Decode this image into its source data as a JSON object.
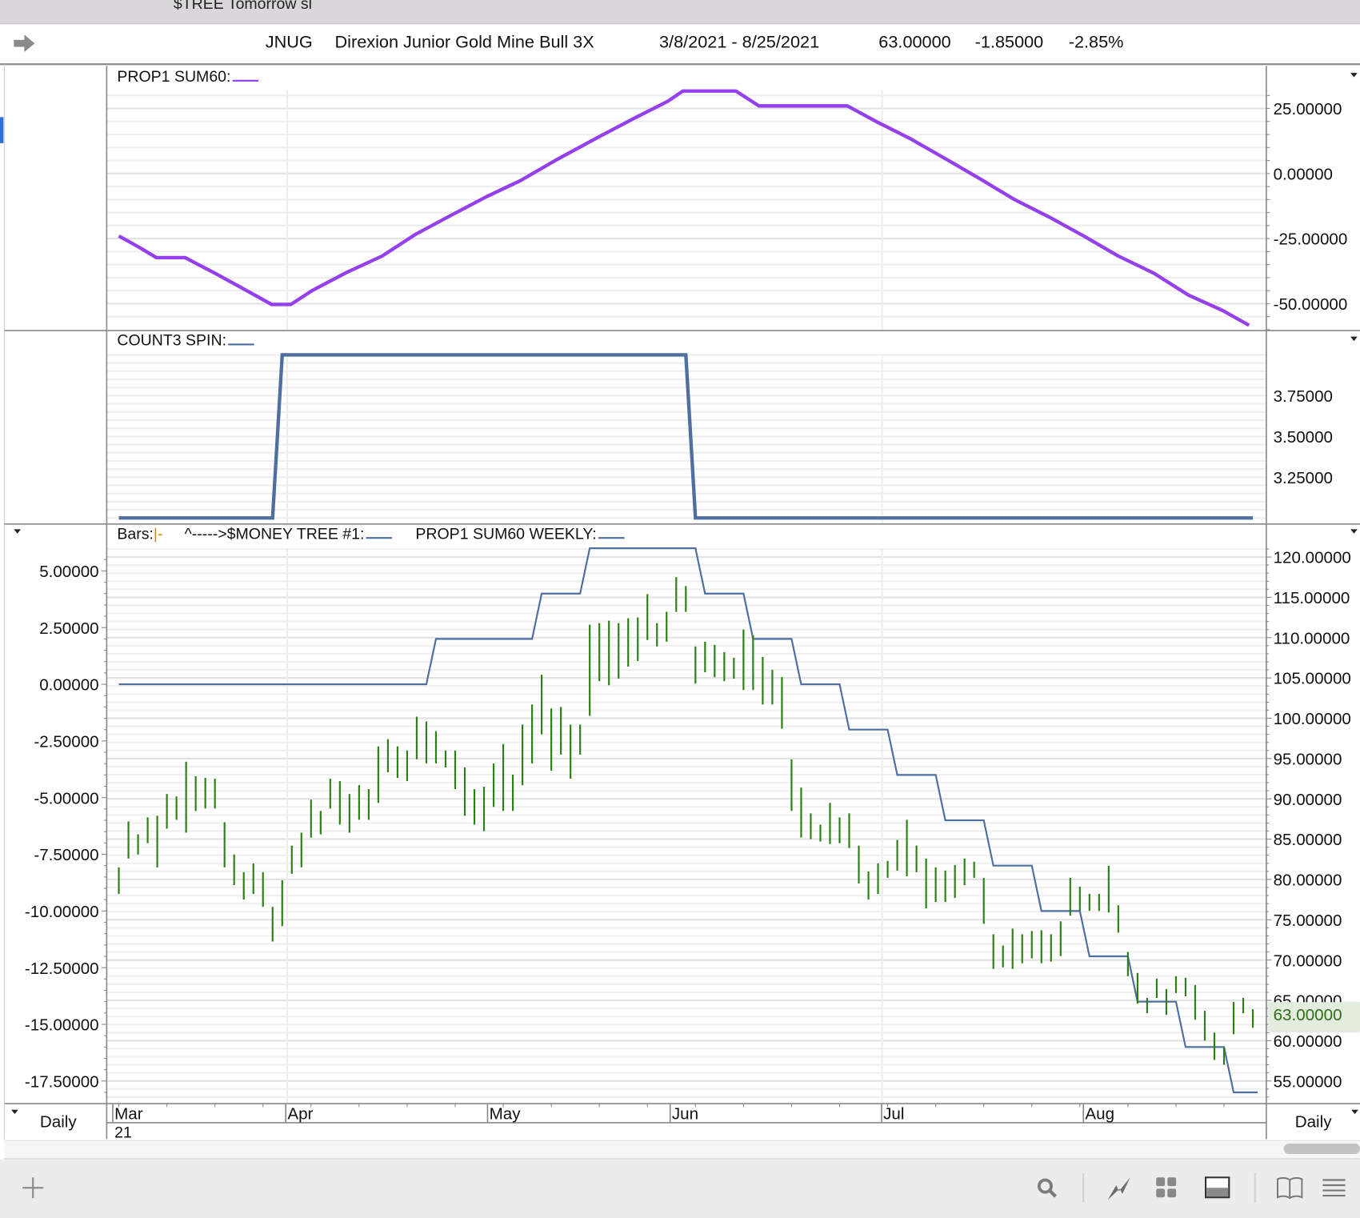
{
  "window": {
    "top_title": "$TREE Tomorrow sl"
  },
  "header": {
    "symbol": "JNUG",
    "name": "Direxion Junior Gold Mine Bull 3X",
    "date_range": "3/8/2021 - 8/25/2021",
    "last": "63.00000",
    "change": "-1.85000",
    "change_pct": "-2.85%"
  },
  "panels": {
    "p1_legend": "PROP1 SUM60:",
    "p2_legend": "COUNT3 SPIN:",
    "p3_legend_bars": "Bars:",
    "p3_legend_bars_glyph": "|-",
    "p3_legend_tree": "^----->$MONEY TREE #1:",
    "p3_legend_weekly": "PROP1 SUM60 WEEKLY:"
  },
  "periodicity_left": "Daily",
  "periodicity_right": "Daily",
  "last_price_tag": "63.00000",
  "colors": {
    "purple": "#9440ee",
    "blue": "#4f6fa0",
    "bar_green": "#2f7d18",
    "tag_bg": "#e3ecdd",
    "tag_text": "#2e6e1c"
  },
  "toolbar_icons": [
    "add-icon",
    "search-icon",
    "chart-style-icon",
    "layout-grid-icon",
    "panel-icon",
    "book-icon",
    "menu-icon"
  ],
  "chart_data": [
    {
      "type": "line",
      "title": "PROP1 SUM60",
      "x_unit": "trading day index (0 = 3/8/2021)",
      "points": [
        [
          0,
          -24
        ],
        [
          2.1,
          -28.3
        ],
        [
          3.9,
          -32.3
        ],
        [
          6.9,
          -32.3
        ],
        [
          10.2,
          -38.7
        ],
        [
          13.8,
          -46
        ],
        [
          15.9,
          -50.3
        ],
        [
          17.9,
          -50.3
        ],
        [
          20.1,
          -45
        ],
        [
          23.7,
          -38
        ],
        [
          27.4,
          -31.7
        ],
        [
          30.9,
          -23.3
        ],
        [
          34.6,
          -16
        ],
        [
          38.2,
          -9
        ],
        [
          41.8,
          -2.7
        ],
        [
          45.4,
          5
        ],
        [
          49.9,
          14
        ],
        [
          53.5,
          21
        ],
        [
          57.1,
          27.7
        ],
        [
          58.7,
          31.7
        ],
        [
          64.2,
          31.7
        ],
        [
          66.6,
          26
        ],
        [
          75.8,
          26
        ],
        [
          78.8,
          20
        ],
        [
          82.4,
          13.3
        ],
        [
          86,
          5.7
        ],
        [
          89.6,
          -2
        ],
        [
          93.2,
          -10
        ],
        [
          96.8,
          -16.7
        ],
        [
          100.4,
          -24
        ],
        [
          104,
          -31.7
        ],
        [
          107.7,
          -38.3
        ],
        [
          111.3,
          -46.7
        ],
        [
          114.9,
          -52.7
        ],
        [
          117.6,
          -58.3
        ]
      ],
      "y_ticks": [
        "25.00000",
        "0.00000",
        "-25.00000",
        "-50.00000"
      ],
      "y_tick_values": [
        25,
        0,
        -25,
        -50
      ]
    },
    {
      "type": "line",
      "title": "COUNT3 SPIN",
      "segments": [
        {
          "from": 0,
          "to": 16,
          "value": 3
        },
        {
          "from": 17,
          "to": 59,
          "value": 4
        },
        {
          "from": 60,
          "to": 118,
          "value": 3
        }
      ],
      "y_ticks": [
        "3.75000",
        "3.50000",
        "3.25000"
      ],
      "y_tick_values": [
        3.75,
        3.5,
        3.25
      ]
    },
    {
      "type": "bar",
      "title": "JNUG daily bars with $MONEY TREE #1 / PROP1 SUM60 WEEKLY",
      "x_ticks": [
        "Mar",
        "Apr",
        "May",
        "Jun",
        "Jul",
        "Aug"
      ],
      "x_tick_index": [
        0,
        18,
        39,
        58,
        80,
        101
      ],
      "x_year_label": "21",
      "right_axis_ticks": [
        "120.00000",
        "115.00000",
        "110.00000",
        "105.00000",
        "100.00000",
        "95.00000",
        "90.00000",
        "85.00000",
        "80.00000",
        "75.00000",
        "70.00000",
        "65.00000",
        "60.00000",
        "55.00000"
      ],
      "right_axis_values": [
        120,
        115,
        110,
        105,
        100,
        95,
        90,
        85,
        80,
        75,
        70,
        65,
        60,
        55
      ],
      "left_axis_ticks": [
        "5.00000",
        "2.50000",
        "0.00000",
        "-2.50000",
        "-5.00000",
        "-7.50000",
        "-10.00000",
        "-12.50000",
        "-15.00000",
        "-17.50000"
      ],
      "left_axis_values": [
        5,
        2.5,
        0,
        -2.5,
        -5,
        -7.5,
        -10,
        -12.5,
        -15,
        -17.5
      ],
      "bars_high_low": [
        [
          81.5,
          78.2
        ],
        [
          87.2,
          82.6
        ],
        [
          85.6,
          83.1
        ],
        [
          87.7,
          84.5
        ],
        [
          87.9,
          81.5
        ],
        [
          90.6,
          86.3
        ],
        [
          90.3,
          87.4
        ],
        [
          94.6,
          85.8
        ],
        [
          92.8,
          88.5
        ],
        [
          92.6,
          88.8
        ],
        [
          92.5,
          88.8
        ],
        [
          87.1,
          81.5
        ],
        [
          83.1,
          79.3
        ],
        [
          80.9,
          77.5
        ],
        [
          82,
          78.2
        ],
        [
          80.9,
          76.6
        ],
        [
          76.6,
          72.3
        ],
        [
          79.9,
          74.2
        ],
        [
          84.2,
          80.7
        ],
        [
          85.8,
          81.5
        ],
        [
          89.9,
          85.2
        ],
        [
          88.5,
          85.6
        ],
        [
          92.5,
          88.8
        ],
        [
          92.2,
          86.8
        ],
        [
          90.6,
          85.8
        ],
        [
          91.7,
          87.4
        ],
        [
          91.2,
          87.4
        ],
        [
          96.5,
          89.5
        ],
        [
          97.4,
          93.3
        ],
        [
          96.5,
          92.6
        ],
        [
          96,
          92.2
        ],
        [
          100.2,
          94.9
        ],
        [
          99.6,
          94.4
        ],
        [
          98.4,
          94.4
        ],
        [
          96,
          93.9
        ],
        [
          96,
          91.2
        ],
        [
          93.9,
          87.9
        ],
        [
          91.2,
          86.8
        ],
        [
          91.5,
          86
        ],
        [
          94.4,
          89
        ],
        [
          96.8,
          88.5
        ],
        [
          93,
          88.5
        ],
        [
          99.2,
          91.7
        ],
        [
          101.7,
          94.4
        ],
        [
          105.4,
          98
        ],
        [
          101.2,
          93.5
        ],
        [
          101.4,
          95.5
        ],
        [
          99.2,
          92.5
        ],
        [
          99.2,
          95.5
        ],
        [
          111.6,
          100.3
        ],
        [
          111.8,
          104.6
        ],
        [
          112.1,
          104.1
        ],
        [
          111.8,
          104.9
        ],
        [
          112.4,
          106.4
        ],
        [
          112.5,
          107.1
        ],
        [
          115.4,
          109.7
        ],
        [
          111.8,
          108.9
        ],
        [
          113.2,
          109.5
        ],
        [
          117.5,
          113.2
        ],
        [
          116.4,
          113.2
        ],
        [
          108.9,
          104.3
        ],
        [
          109.5,
          105.7
        ],
        [
          109.1,
          105.1
        ],
        [
          108.2,
          104.6
        ],
        [
          107.5,
          104.9
        ],
        [
          111,
          103.5
        ],
        [
          110.3,
          103.5
        ],
        [
          107.6,
          101.7
        ],
        [
          106,
          101.7
        ],
        [
          105.1,
          98.7
        ],
        [
          94.9,
          88.5
        ],
        [
          91.4,
          85.2
        ],
        [
          88.2,
          85
        ],
        [
          86.8,
          84.7
        ],
        [
          89.5,
          84.4
        ],
        [
          87.7,
          84.5
        ],
        [
          88.2,
          83.9
        ],
        [
          84.2,
          79.5
        ],
        [
          81,
          77.5
        ],
        [
          82,
          78.2
        ],
        [
          82.3,
          80.2
        ],
        [
          84.9,
          81.1
        ],
        [
          87.4,
          80.4
        ],
        [
          84.2,
          80.9
        ],
        [
          82.6,
          76.4
        ],
        [
          81.5,
          77.2
        ],
        [
          81.1,
          77.2
        ],
        [
          81.8,
          77.7
        ],
        [
          82.6,
          79.3
        ],
        [
          82.2,
          80.2
        ],
        [
          80.2,
          74.5
        ],
        [
          73.2,
          68.9
        ],
        [
          71.8,
          69.1
        ],
        [
          73.9,
          68.9
        ],
        [
          73.2,
          69.6
        ],
        [
          73.6,
          70.2
        ],
        [
          73.7,
          69.6
        ],
        [
          73.2,
          69.8
        ],
        [
          74.8,
          70.5
        ],
        [
          80.2,
          75.5
        ],
        [
          79.1,
          76.1
        ],
        [
          78.2,
          76.1
        ],
        [
          78.2,
          76.1
        ],
        [
          81.7,
          75.9
        ],
        [
          76.8,
          73.4
        ],
        [
          71,
          68
        ],
        [
          68.4,
          64.6
        ],
        [
          65.3,
          63.4
        ],
        [
          67.7,
          65.3
        ],
        [
          66.4,
          63.2
        ],
        [
          68,
          65.9
        ],
        [
          67.8,
          65.5
        ],
        [
          66.9,
          62.6
        ],
        [
          63.7,
          60
        ],
        [
          61,
          57.6
        ],
        [
          59.2,
          57
        ],
        [
          64.8,
          60.8
        ],
        [
          65.3,
          63.4
        ],
        [
          63.9,
          61.6
        ]
      ],
      "weekly_steps_left_axis": [
        [
          0,
          0
        ],
        [
          32,
          2
        ],
        [
          43,
          4
        ],
        [
          48,
          6
        ],
        [
          60,
          4
        ],
        [
          65,
          2
        ],
        [
          70,
          0
        ],
        [
          75,
          -2
        ],
        [
          80,
          -4
        ],
        [
          85,
          -6
        ],
        [
          90,
          -8
        ],
        [
          95,
          -10
        ],
        [
          100,
          -12
        ],
        [
          105,
          -14
        ],
        [
          110,
          -16
        ],
        [
          115,
          -18
        ]
      ],
      "last_value": 63.0
    }
  ]
}
